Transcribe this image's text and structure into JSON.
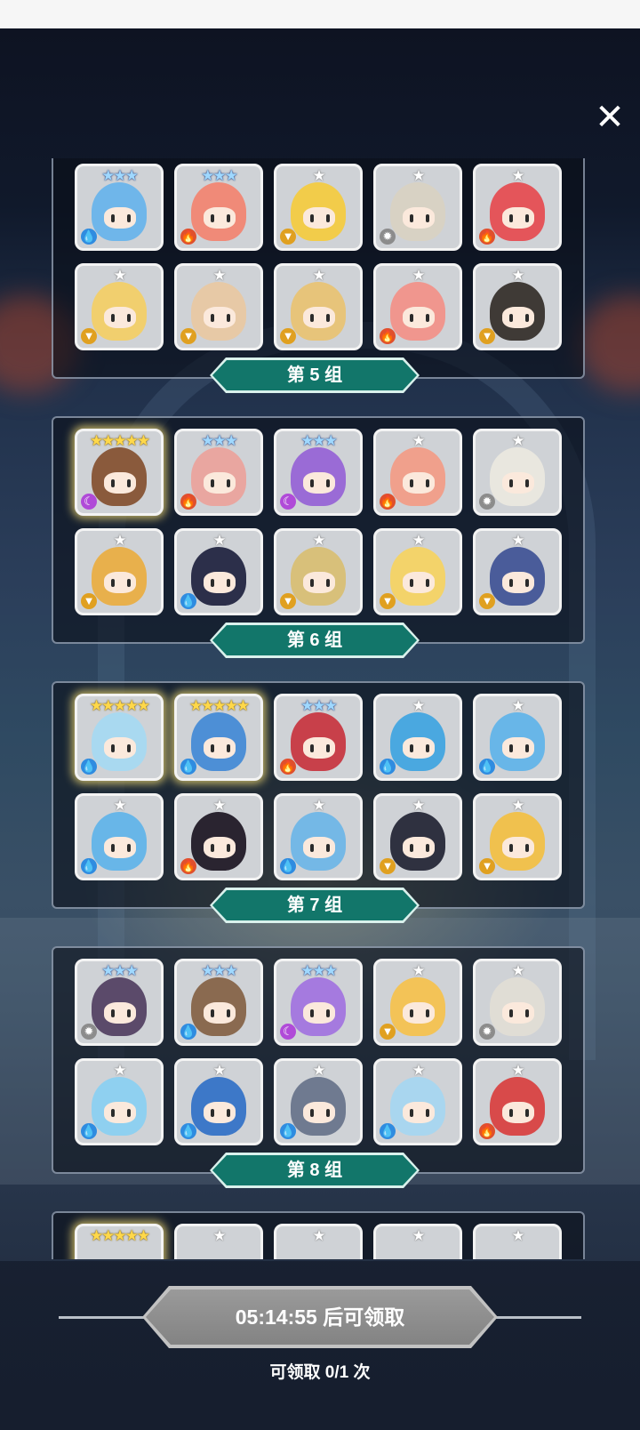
{
  "close_icon": "close-icon",
  "groups": [
    {
      "label": "第 5 组",
      "heroes": [
        {
          "stars": 3,
          "tier": "blue",
          "element": "water",
          "color": "#6fb6ea"
        },
        {
          "stars": 3,
          "tier": "blue",
          "element": "fire",
          "color": "#f08a78"
        },
        {
          "stars": 1,
          "tier": "grey",
          "element": "earth",
          "color": "#f2cc4a"
        },
        {
          "stars": 1,
          "tier": "grey",
          "element": "light",
          "color": "#d8d2c4"
        },
        {
          "stars": 1,
          "tier": "grey",
          "element": "fire",
          "color": "#e4555a"
        },
        {
          "stars": 1,
          "tier": "grey",
          "element": "earth",
          "color": "#f1cf6e"
        },
        {
          "stars": 1,
          "tier": "grey",
          "element": "earth",
          "color": "#e7c9a6"
        },
        {
          "stars": 1,
          "tier": "grey",
          "element": "earth",
          "color": "#e7c47a"
        },
        {
          "stars": 1,
          "tier": "grey",
          "element": "fire",
          "color": "#f0968e"
        },
        {
          "stars": 1,
          "tier": "grey",
          "element": "earth",
          "color": "#3f3a36"
        }
      ]
    },
    {
      "label": "第 6 组",
      "heroes": [
        {
          "stars": 5,
          "tier": "gold",
          "element": "dark",
          "color": "#8a5a3c"
        },
        {
          "stars": 3,
          "tier": "blue",
          "element": "fire",
          "color": "#e9a6a0"
        },
        {
          "stars": 3,
          "tier": "blue",
          "element": "dark",
          "color": "#9a6bd6"
        },
        {
          "stars": 1,
          "tier": "grey",
          "element": "fire",
          "color": "#f0a08c"
        },
        {
          "stars": 1,
          "tier": "grey",
          "element": "light",
          "color": "#e9e7df"
        },
        {
          "stars": 1,
          "tier": "grey",
          "element": "earth",
          "color": "#e8b04c"
        },
        {
          "stars": 1,
          "tier": "grey",
          "element": "water",
          "color": "#2c2f4a"
        },
        {
          "stars": 1,
          "tier": "grey",
          "element": "earth",
          "color": "#d8c07a"
        },
        {
          "stars": 1,
          "tier": "grey",
          "element": "earth",
          "color": "#f3d36a"
        },
        {
          "stars": 1,
          "tier": "grey",
          "element": "earth",
          "color": "#4a5c9a"
        }
      ]
    },
    {
      "label": "第 7 组",
      "heroes": [
        {
          "stars": 5,
          "tier": "gold",
          "element": "water",
          "color": "#a9d9f0"
        },
        {
          "stars": 5,
          "tier": "gold",
          "element": "water",
          "color": "#4d8fd6"
        },
        {
          "stars": 3,
          "tier": "blue",
          "element": "fire",
          "color": "#c8404a"
        },
        {
          "stars": 1,
          "tier": "grey",
          "element": "water",
          "color": "#4aa8e0"
        },
        {
          "stars": 1,
          "tier": "grey",
          "element": "water",
          "color": "#68b6e8"
        },
        {
          "stars": 1,
          "tier": "grey",
          "element": "water",
          "color": "#68b6e8"
        },
        {
          "stars": 1,
          "tier": "grey",
          "element": "fire",
          "color": "#2a2430"
        },
        {
          "stars": 1,
          "tier": "grey",
          "element": "water",
          "color": "#74b8e6"
        },
        {
          "stars": 1,
          "tier": "grey",
          "element": "earth",
          "color": "#2f3140"
        },
        {
          "stars": 1,
          "tier": "grey",
          "element": "earth",
          "color": "#f0c14e"
        }
      ]
    },
    {
      "label": "第 8 组",
      "heroes": [
        {
          "stars": 3,
          "tier": "blue",
          "element": "light",
          "color": "#5b4a6a"
        },
        {
          "stars": 3,
          "tier": "blue",
          "element": "water",
          "color": "#8a6a50"
        },
        {
          "stars": 3,
          "tier": "blue",
          "element": "dark",
          "color": "#a57adf"
        },
        {
          "stars": 1,
          "tier": "grey",
          "element": "earth",
          "color": "#f3c357"
        },
        {
          "stars": 1,
          "tier": "grey",
          "element": "light",
          "color": "#e0ddd5"
        },
        {
          "stars": 1,
          "tier": "grey",
          "element": "water",
          "color": "#8fd0f0"
        },
        {
          "stars": 1,
          "tier": "grey",
          "element": "water",
          "color": "#3d78c8"
        },
        {
          "stars": 1,
          "tier": "grey",
          "element": "water",
          "color": "#6f7a90"
        },
        {
          "stars": 1,
          "tier": "grey",
          "element": "water",
          "color": "#a9d6ef"
        },
        {
          "stars": 1,
          "tier": "grey",
          "element": "fire",
          "color": "#d84a4a"
        }
      ]
    },
    {
      "label": "",
      "heroes": [
        {
          "stars": 5,
          "tier": "gold",
          "element": "",
          "color": "#cfd2d6"
        },
        {
          "stars": 1,
          "tier": "grey",
          "element": "",
          "color": "#cfd2d6"
        },
        {
          "stars": 1,
          "tier": "grey",
          "element": "",
          "color": "#cfd2d6"
        },
        {
          "stars": 1,
          "tier": "grey",
          "element": "",
          "color": "#cfd2d6"
        },
        {
          "stars": 1,
          "tier": "grey",
          "element": "",
          "color": "#cfd2d6"
        }
      ]
    }
  ],
  "element_colors": {
    "water": "#2f8ce0",
    "fire": "#e0502c",
    "earth": "#e0a020",
    "light": "#8c8c8c",
    "dark": "#b04ad8"
  },
  "element_glyphs": {
    "water": "💧",
    "fire": "🔥",
    "earth": "▼",
    "light": "✹",
    "dark": "☾"
  },
  "footer": {
    "claim_label": "05:14:55 后可领取",
    "claim_count": "可领取 0/1 次"
  }
}
